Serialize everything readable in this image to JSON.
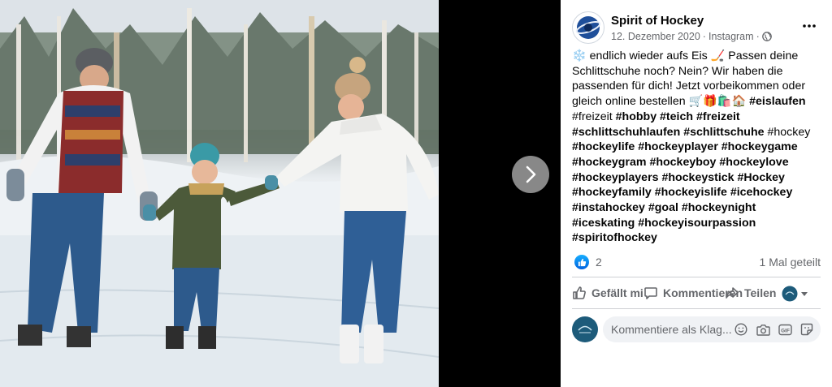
{
  "post": {
    "page_name": "Spirit of Hockey",
    "date": "12. Dezember 2020",
    "separator": "·",
    "source": "Instagram",
    "separator2": "·",
    "audience_icon": "globe-icon",
    "more_icon": "more-dots-icon",
    "text_segments": [
      {
        "text": "❄️ endlich wieder aufs Eis 🏒 Passen deine Schlittschuhe noch? Nein? Wir haben die passenden für dich! Jetzt vorbeikommen oder gleich online bestellen 🛒🎁🛍️🏠 ",
        "style": "normal"
      },
      {
        "text": "#eislaufen",
        "style": "bold"
      },
      {
        "text": " ",
        "style": "normal"
      },
      {
        "text": "#freizeit",
        "style": "plain-tag"
      },
      {
        "text": " ",
        "style": "normal"
      },
      {
        "text": "#hobby",
        "style": "bold"
      },
      {
        "text": " ",
        "style": "normal"
      },
      {
        "text": "#teich",
        "style": "bold"
      },
      {
        "text": " ",
        "style": "normal"
      },
      {
        "text": "#freizeit",
        "style": "bold"
      },
      {
        "text": " ",
        "style": "normal"
      },
      {
        "text": "#schlittschuhlaufen",
        "style": "bold"
      },
      {
        "text": " ",
        "style": "normal"
      },
      {
        "text": "#schlittschuhe",
        "style": "bold"
      },
      {
        "text": " ",
        "style": "normal"
      },
      {
        "text": "#hockey",
        "style": "plain-tag"
      },
      {
        "text": " ",
        "style": "normal"
      },
      {
        "text": "#hockeylife",
        "style": "bold"
      },
      {
        "text": " ",
        "style": "normal"
      },
      {
        "text": "#hockeyplayer",
        "style": "bold"
      },
      {
        "text": " ",
        "style": "normal"
      },
      {
        "text": "#hockeygame",
        "style": "bold"
      },
      {
        "text": " ",
        "style": "normal"
      },
      {
        "text": "#hockeygram",
        "style": "bold"
      },
      {
        "text": " ",
        "style": "normal"
      },
      {
        "text": "#hockeyboy",
        "style": "bold"
      },
      {
        "text": " ",
        "style": "normal"
      },
      {
        "text": "#hockeylove",
        "style": "bold"
      },
      {
        "text": " ",
        "style": "normal"
      },
      {
        "text": "#hockeyplayers",
        "style": "bold"
      },
      {
        "text": " ",
        "style": "normal"
      },
      {
        "text": "#hockeystick",
        "style": "bold"
      },
      {
        "text": " ",
        "style": "normal"
      },
      {
        "text": "#Hockey",
        "style": "bold"
      },
      {
        "text": " ",
        "style": "normal"
      },
      {
        "text": "#hockeyfamily",
        "style": "bold"
      },
      {
        "text": " ",
        "style": "normal"
      },
      {
        "text": "#hockeyislife",
        "style": "bold"
      },
      {
        "text": " ",
        "style": "normal"
      },
      {
        "text": "#icehockey",
        "style": "bold"
      },
      {
        "text": " ",
        "style": "normal"
      },
      {
        "text": "#instahockey",
        "style": "bold"
      },
      {
        "text": " ",
        "style": "normal"
      },
      {
        "text": "#goal",
        "style": "bold"
      },
      {
        "text": " ",
        "style": "normal"
      },
      {
        "text": "#hockeynight",
        "style": "bold"
      },
      {
        "text": " ",
        "style": "normal"
      },
      {
        "text": "#iceskating",
        "style": "bold"
      },
      {
        "text": " ",
        "style": "normal"
      },
      {
        "text": "#hockeyisourpassion",
        "style": "bold"
      },
      {
        "text": " ",
        "style": "normal"
      },
      {
        "text": "#spiritofhockey",
        "style": "bold"
      }
    ]
  },
  "reactions": {
    "icon": "like-reaction-icon",
    "count": "2",
    "shares": "1 Mal geteilt"
  },
  "actions": {
    "like_label": "Gefällt mi",
    "comment_label": "Kommentieren",
    "share_label": "Teilen",
    "like_icon": "thumbs-up-icon",
    "comment_icon": "comment-bubble-icon",
    "share_icon": "share-arrow-icon",
    "audience_icon": "page-avatar-dropdown-icon"
  },
  "comment_box": {
    "placeholder": "Kommentiere als Klag...",
    "avatar_label": "commenter-avatar",
    "icons": [
      "emoji-icon",
      "camera-icon",
      "gif-icon",
      "sticker-icon"
    ]
  },
  "viewer": {
    "next_icon": "chevron-right-icon"
  },
  "colors": {
    "accent": "#1877f2",
    "text_primary": "#050505",
    "text_secondary": "#65676b",
    "divider": "#ced0d4",
    "input_bg": "#f0f2f5"
  }
}
